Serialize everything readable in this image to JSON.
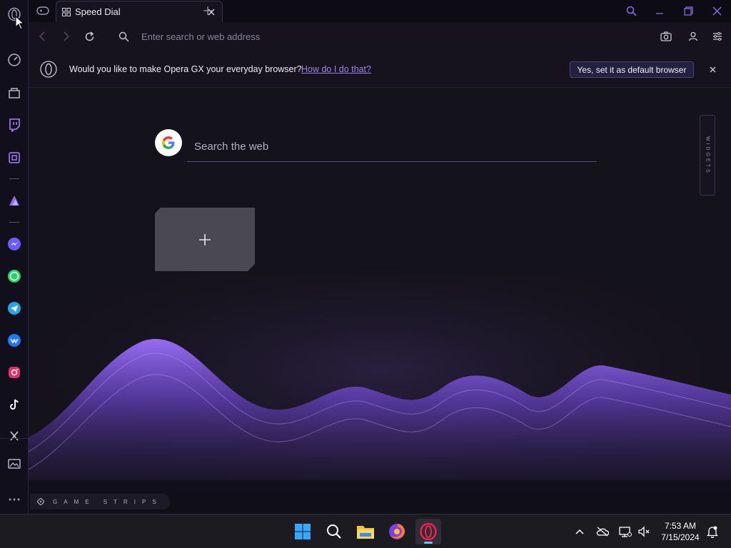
{
  "browser": {
    "tab_title": "Speed Dial",
    "address_placeholder": "Enter search or web address"
  },
  "notification": {
    "message": "Would you like to make Opera GX your everyday browser?",
    "link": "How do I do that?",
    "button": "Yes, set it as default browser"
  },
  "speed_dial": {
    "search_placeholder": "Search the web",
    "widgets_label": "WIDGETS",
    "game_strips_label": "GAME STRIPS"
  },
  "sidebar": {
    "items": [
      "speed-dial-gauge",
      "gx-corner",
      "twitch",
      "hardware-monitor",
      "aria",
      "messenger",
      "whatsapp",
      "telegram",
      "vk",
      "instagram",
      "tiktok",
      "x"
    ]
  },
  "taskbar": {
    "time": "7:53 AM",
    "date": "7/15/2024",
    "apps": [
      "windows-start",
      "search",
      "file-explorer",
      "firefox",
      "opera-gx"
    ]
  },
  "colors": {
    "accent": "#8b6cf0",
    "background": "#14121a",
    "taskbar": "#1c1b22"
  }
}
